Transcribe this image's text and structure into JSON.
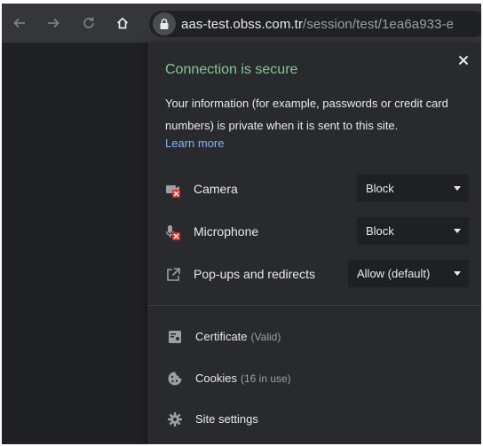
{
  "toolbar": {
    "back_icon": "back-arrow-icon",
    "forward_icon": "forward-arrow-icon",
    "reload_icon": "reload-icon",
    "home_icon": "home-icon",
    "lock_icon": "lock-icon",
    "url_host": "aas-test.obss.com.tr",
    "url_path": "/session/test/1ea6a933-e"
  },
  "popup": {
    "title": "Connection is secure",
    "description": "Your information (for example, passwords or credit card numbers) is private when it is sent to this site.",
    "learn_more": "Learn more",
    "close_icon": "close-icon",
    "permissions": [
      {
        "icon": "camera-blocked-icon",
        "label": "Camera",
        "value": "Block"
      },
      {
        "icon": "microphone-blocked-icon",
        "label": "Microphone",
        "value": "Block"
      },
      {
        "icon": "popup-redirect-icon",
        "label": "Pop-ups and redirects",
        "value": "Allow (default)"
      }
    ],
    "info_rows": [
      {
        "icon": "certificate-icon",
        "label": "Certificate",
        "sub": "(Valid)"
      },
      {
        "icon": "cookie-icon",
        "label": "Cookies",
        "sub": "(16 in use)"
      },
      {
        "icon": "gear-icon",
        "label": "Site settings",
        "sub": ""
      }
    ]
  },
  "colors": {
    "toolbar_bg": "#35363a",
    "popup_bg": "#292a2d",
    "secure_green": "#81c995",
    "link_blue": "#8ab4f8",
    "blocked_red": "#d93025"
  }
}
